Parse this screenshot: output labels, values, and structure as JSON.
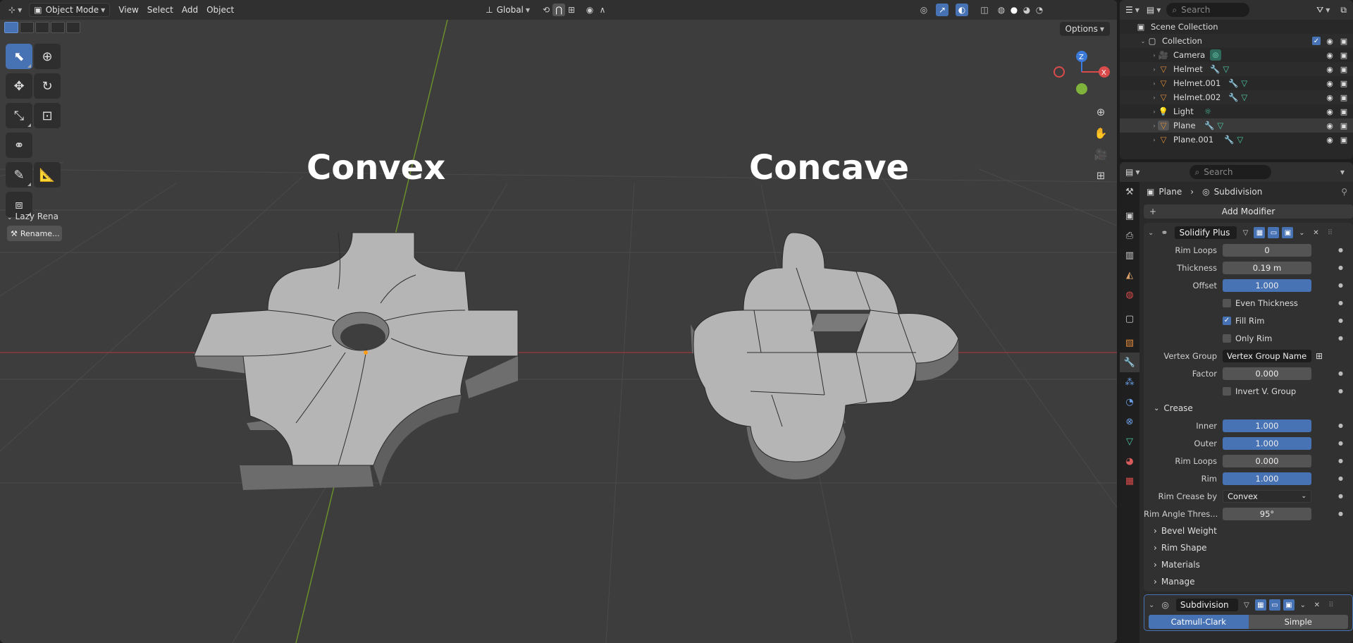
{
  "header": {
    "mode": "Object Mode",
    "menus": [
      "View",
      "Select",
      "Add",
      "Object"
    ],
    "orientation": "Global"
  },
  "tool_panel": {
    "title": "Lazy Rena",
    "rename_button": "Rename..."
  },
  "viewport": {
    "options_label": "Options",
    "label_left": "Convex",
    "label_right": "Concave",
    "gizmo": {
      "z": "Z",
      "x": "X"
    }
  },
  "outliner": {
    "search_placeholder": "Search",
    "scene_collection": "Scene Collection",
    "collection": "Collection",
    "items": [
      {
        "name": "Camera"
      },
      {
        "name": "Helmet"
      },
      {
        "name": "Helmet.001"
      },
      {
        "name": "Helmet.002"
      },
      {
        "name": "Light"
      },
      {
        "name": "Plane"
      },
      {
        "name": "Plane.001"
      }
    ]
  },
  "properties": {
    "search_placeholder": "Search",
    "breadcrumb_object": "Plane",
    "breadcrumb_modifier": "Subdivision",
    "add_modifier": "Add Modifier",
    "solidify": {
      "name": "Solidify Plus",
      "rim_loops_label": "Rim Loops",
      "rim_loops": "0",
      "thickness_label": "Thickness",
      "thickness": "0.19 m",
      "offset_label": "Offset",
      "offset": "1.000",
      "even_thickness": "Even Thickness",
      "fill_rim": "Fill Rim",
      "only_rim": "Only Rim",
      "vertex_group_label": "Vertex Group",
      "vertex_group": "Vertex Group Name",
      "factor_label": "Factor",
      "factor": "0.000",
      "invert_group": "Invert V. Group",
      "crease_title": "Crease",
      "inner_label": "Inner",
      "inner": "1.000",
      "outer_label": "Outer",
      "outer": "1.000",
      "crease_rim_loops_label": "Rim Loops",
      "crease_rim_loops": "0.000",
      "rim_label": "Rim",
      "rim": "1.000",
      "rim_crease_by_label": "Rim Crease by",
      "rim_crease_by": "Convex",
      "rim_angle_label": "Rim Angle Thres...",
      "rim_angle": "95°",
      "sections": [
        "Bevel Weight",
        "Rim Shape",
        "Materials",
        "Manage"
      ]
    },
    "subdivision": {
      "name": "Subdivision",
      "mode_a": "Catmull-Clark",
      "mode_b": "Simple"
    }
  }
}
